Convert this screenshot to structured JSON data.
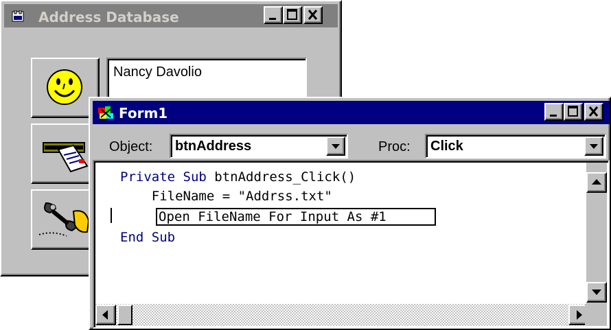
{
  "address_window": {
    "title": "Address Database",
    "name_value": "Nancy Davolio",
    "buttons": [
      {
        "icon": "smiley-face-icon"
      },
      {
        "icon": "card-reader-icon"
      },
      {
        "icon": "phone-dialer-icon"
      }
    ]
  },
  "form1": {
    "title": "Form1",
    "object_label": "Object:",
    "object_value": "btnAddress",
    "proc_label": "Proc:",
    "proc_value": "Click",
    "code": {
      "line1_kw": "Private Sub",
      "line1_rest": " btnAddress_Click()",
      "line2": "    FileName = \"Addrss.txt\"",
      "line3": "Open FileName For Input As #1",
      "line4_kw": "End Sub"
    }
  },
  "colors": {
    "active_titlebar": "#000080",
    "inactive_titlebar": "#808080",
    "face": "#c0c0c0",
    "keyword": "#000080"
  }
}
